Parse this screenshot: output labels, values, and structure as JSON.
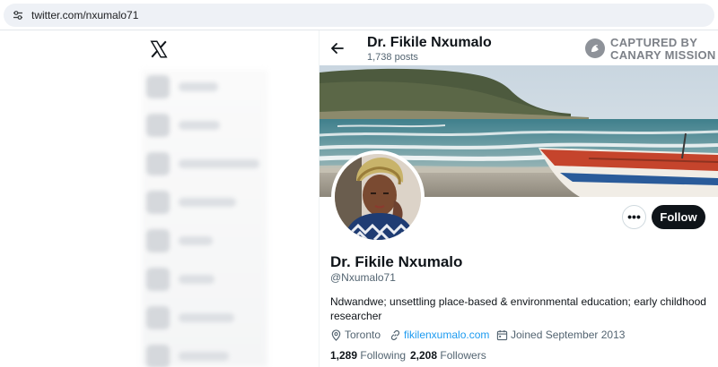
{
  "browser": {
    "url": "twitter.com/nxumalo71"
  },
  "nav": {
    "logo_icon": "x-logo-icon",
    "items": [
      {
        "icon": "home-icon"
      },
      {
        "icon": "explore-icon"
      },
      {
        "icon": "notifications-icon"
      },
      {
        "icon": "messages-icon"
      },
      {
        "icon": "lists-icon"
      },
      {
        "icon": "bookmarks-icon"
      },
      {
        "icon": "communities-icon"
      },
      {
        "icon": "profile-icon"
      }
    ]
  },
  "header": {
    "name": "Dr. Fikile Nxumalo",
    "posts": "1,738 posts"
  },
  "watermark": {
    "line1": "CAPTURED BY",
    "line2": "CANARY MISSION"
  },
  "profile": {
    "display_name": "Dr. Fikile Nxumalo",
    "handle": "@Nxumalo71",
    "bio": "Ndwandwe; unsettling place-based & environmental education; early childhood researcher",
    "location": "Toronto",
    "website": "fikilenxumalo.com",
    "joined": "Joined September 2013",
    "following_count": "1,289",
    "following_label": "Following",
    "followers_count": "2,208",
    "followers_label": "Followers"
  },
  "actions": {
    "more_label": "•••",
    "follow_label": "Follow"
  },
  "colors": {
    "accent": "#1d9bf0",
    "text_primary": "#0f1419",
    "text_secondary": "#536471",
    "follow_button_bg": "#0f1419"
  }
}
